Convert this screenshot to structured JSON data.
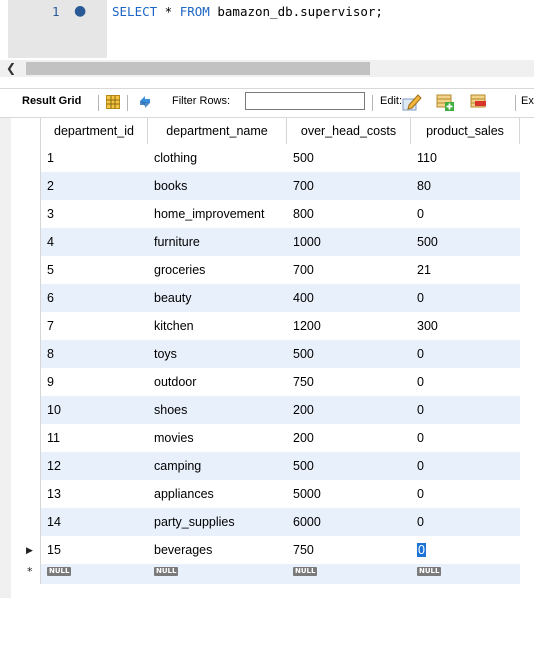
{
  "editor": {
    "line_number": "1",
    "sql_select": "SELECT",
    "sql_star": " * ",
    "sql_from": "FROM",
    "sql_table": " bamazon_db.supervisor;"
  },
  "toolbar": {
    "result_grid_label": "Result Grid",
    "filter_rows_label": "Filter Rows:",
    "filter_value": "",
    "edit_label": "Edit:",
    "export_label": "Ex"
  },
  "grid": {
    "columns": [
      "department_id",
      "department_name",
      "over_head_costs",
      "product_sales"
    ],
    "rows": [
      [
        "1",
        "clothing",
        "500",
        "110"
      ],
      [
        "2",
        "books",
        "700",
        "80"
      ],
      [
        "3",
        "home_improvement",
        "800",
        "0"
      ],
      [
        "4",
        "furniture",
        "1000",
        "500"
      ],
      [
        "5",
        "groceries",
        "700",
        "21"
      ],
      [
        "6",
        "beauty",
        "400",
        "0"
      ],
      [
        "7",
        "kitchen",
        "1200",
        "300"
      ],
      [
        "8",
        "toys",
        "500",
        "0"
      ],
      [
        "9",
        "outdoor",
        "750",
        "0"
      ],
      [
        "10",
        "shoes",
        "200",
        "0"
      ],
      [
        "11",
        "movies",
        "200",
        "0"
      ],
      [
        "12",
        "camping",
        "500",
        "0"
      ],
      [
        "13",
        "appliances",
        "5000",
        "0"
      ],
      [
        "14",
        "party_supplies",
        "6000",
        "0"
      ],
      [
        "15",
        "beverages",
        "750",
        "0"
      ]
    ],
    "null_label": "NULL",
    "row_alt_color": "#e8f0fb"
  },
  "icons": {
    "scroll_left": "chevron-left-icon",
    "grid": "grid-icon",
    "refresh": "refresh-icon",
    "edit": "edit-icon",
    "add_row": "add-row-icon",
    "delete_row": "delete-row-icon"
  }
}
